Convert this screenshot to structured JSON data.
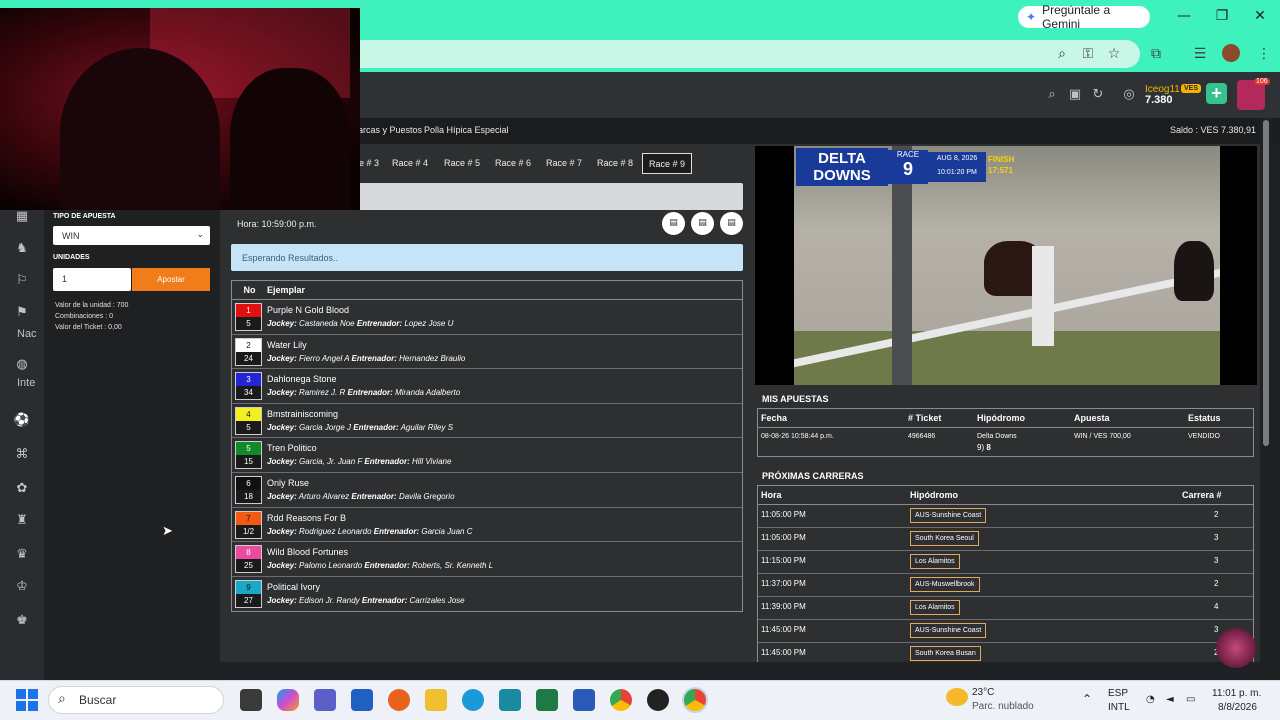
{
  "browser": {
    "gemini_label": "Pregúntale a Gemini",
    "minimize": "—",
    "maximize": "❐",
    "close": "✕"
  },
  "header": {
    "username": "Iceog11",
    "vip": "VES",
    "balance": "7.380",
    "avatar_count": "106",
    "add_label": "+"
  },
  "subnav": {
    "links": [
      "arcas y Puestos",
      "Polla Hípica Especial"
    ],
    "saldo": "Saldo : VES 7.380,91"
  },
  "sidebar": {
    "texts": [
      "Nac",
      "Inte"
    ]
  },
  "bet_panel": {
    "type_label": "TIPO DE APUESTA",
    "type_value": "WIN",
    "units_label": "UNIDADES",
    "units_value": "1",
    "submit": "Apostar",
    "unit_value": "Valor de la unidad : 700",
    "combinations": "Combinaciones : 0",
    "ticket_value": "Valor del Ticket : 0,00"
  },
  "race_tabs": [
    "e # 3",
    "Race # 4",
    "Race # 5",
    "Race # 6",
    "Race # 7",
    "Race # 8",
    "Race # 9"
  ],
  "race_info": {
    "hora": "Hora: 10:59:00 p.m.",
    "waiting": "Esperando Resultados.."
  },
  "runners_table": {
    "col_no": "No",
    "col_name": "Ejemplar",
    "jockey_label": "Jockey:",
    "trainer_label": "Entrenador:",
    "rows": [
      {
        "no": "1",
        "odds": "5",
        "color": "#e01010",
        "text": "#fff",
        "name": "Purple N Gold Blood",
        "jockey": "Castaneda Noe",
        "trainer": "Lopez Jose U"
      },
      {
        "no": "2",
        "odds": "24",
        "color": "#ffffff",
        "text": "#111",
        "name": "Water Lily",
        "jockey": "Fierro Angel A",
        "trainer": "Hernandez Braulio"
      },
      {
        "no": "3",
        "odds": "34",
        "color": "#2424d8",
        "text": "#fff",
        "name": "Dahlonega Stone",
        "jockey": "Ramirez J. R",
        "trainer": "Miranda Adalberto"
      },
      {
        "no": "4",
        "odds": "5",
        "color": "#f4f020",
        "text": "#111",
        "name": "Bmstrainiscoming",
        "jockey": "Garcia Jorge J",
        "trainer": "Aguilar Riley S"
      },
      {
        "no": "5",
        "odds": "15",
        "color": "#138a2a",
        "text": "#fff",
        "name": "Tren Politico",
        "jockey": "Garcia, Jr. Juan F",
        "trainer": "Hill Viviane"
      },
      {
        "no": "6",
        "odds": "18",
        "color": "#111111",
        "text": "#fff",
        "name": "Only Ruse",
        "jockey": "Arturo Alvarez",
        "trainer": "Davila Gregorio"
      },
      {
        "no": "7",
        "odds": "1/2",
        "color": "#f05a14",
        "text": "#111",
        "name": "Rdd Reasons For B",
        "jockey": "Rodriguez Leonardo",
        "trainer": "Garcia Juan C"
      },
      {
        "no": "8",
        "odds": "25",
        "color": "#ec4aa0",
        "text": "#fff",
        "name": "Wild Blood Fortunes",
        "jockey": "Palomo Leonardo",
        "trainer": "Roberts, Sr. Kenneth L"
      },
      {
        "no": "9",
        "odds": "27",
        "color": "#1aa8c8",
        "text": "#111",
        "name": "Political Ivory",
        "jockey": "Edison Jr. Randy",
        "trainer": "Carrizales Jose"
      }
    ]
  },
  "video": {
    "logo_line1": "DELTA",
    "logo_line2": "DOWNS",
    "race_label": "RACE",
    "race_number": "9",
    "date": "AUG 8, 2026",
    "time": "10:01:20 PM",
    "finish_label": "FINISH",
    "finish_time": "17:571"
  },
  "my_bets": {
    "title": "MIS APUESTAS",
    "headers": [
      "Fecha",
      "# Ticket",
      "Hipódromo",
      "Apuesta",
      "Estatus"
    ],
    "row": {
      "fecha": "08-08-26 10:58:44 p.m.",
      "ticket": "4966486",
      "hipodromo": "Delta Downs",
      "detail_race": "9)",
      "detail_horse": "8",
      "apuesta": "WIN / VES 700,00",
      "estatus": "VENDIDO"
    }
  },
  "upcoming": {
    "title": "PRÓXIMAS CARRERAS",
    "headers": [
      "Hora",
      "Hipódromo",
      "Carrera #"
    ],
    "rows": [
      {
        "hora": "11:05:00 PM",
        "hipodromo": "AUS-Sunshine Coast",
        "carrera": "2"
      },
      {
        "hora": "11:05:00 PM",
        "hipodromo": "South Korea Seoul",
        "carrera": "3"
      },
      {
        "hora": "11:15:00 PM",
        "hipodromo": "Los Alamitos",
        "carrera": "3"
      },
      {
        "hora": "11:37:00 PM",
        "hipodromo": "AUS-Muswellbrook",
        "carrera": "2"
      },
      {
        "hora": "11:39:00 PM",
        "hipodromo": "Los Alamitos",
        "carrera": "4"
      },
      {
        "hora": "11:45:00 PM",
        "hipodromo": "AUS-Sunshine Coast",
        "carrera": "3"
      },
      {
        "hora": "11:45:00 PM",
        "hipodromo": "South Korea Busan",
        "carrera": "2"
      }
    ]
  },
  "taskbar": {
    "search": "Buscar",
    "temp": "23°C",
    "weather": "Parc. nublado",
    "lang1": "ESP",
    "lang2": "INTL",
    "time": "11:01 p. m.",
    "date": "8/8/2026"
  }
}
